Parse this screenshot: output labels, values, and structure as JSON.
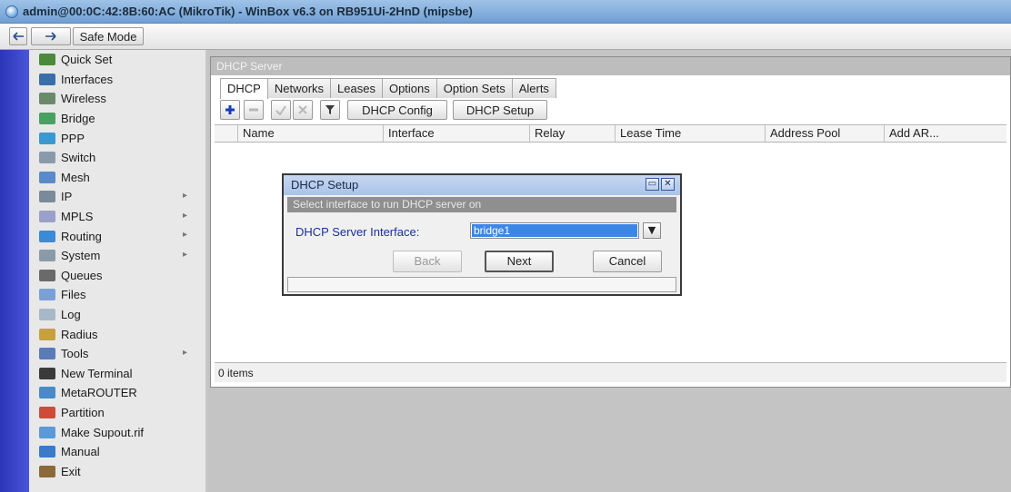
{
  "window": {
    "title": "admin@00:0C:42:8B:60:AC (MikroTik) - WinBox v6.3 on RB951Ui-2HnD (mipsbe)"
  },
  "toolbar": {
    "undo_icon": "undo-icon",
    "redo_icon": "redo-icon",
    "safe_mode_label": "Safe Mode"
  },
  "sidebar": {
    "items": [
      {
        "label": "Quick Set",
        "icon": "quick-set-icon",
        "color": "#4a8a3a",
        "submenu": false
      },
      {
        "label": "Interfaces",
        "icon": "interfaces-icon",
        "color": "#3a6ea8",
        "submenu": false
      },
      {
        "label": "Wireless",
        "icon": "wireless-icon",
        "color": "#6a8a6a",
        "submenu": false
      },
      {
        "label": "Bridge",
        "icon": "bridge-icon",
        "color": "#4aa060",
        "submenu": false
      },
      {
        "label": "PPP",
        "icon": "ppp-icon",
        "color": "#3a9ad0",
        "submenu": false
      },
      {
        "label": "Switch",
        "icon": "switch-icon",
        "color": "#8a9aaa",
        "submenu": false
      },
      {
        "label": "Mesh",
        "icon": "mesh-icon",
        "color": "#5a8ac8",
        "submenu": false
      },
      {
        "label": "IP",
        "icon": "ip-icon",
        "color": "#7a8a9a",
        "submenu": true
      },
      {
        "label": "MPLS",
        "icon": "mpls-icon",
        "color": "#9aa0c8",
        "submenu": true
      },
      {
        "label": "Routing",
        "icon": "routing-icon",
        "color": "#3a8ad8",
        "submenu": true
      },
      {
        "label": "System",
        "icon": "system-icon",
        "color": "#8a9aa8",
        "submenu": true
      },
      {
        "label": "Queues",
        "icon": "queues-icon",
        "color": "#6a6a6a",
        "submenu": false
      },
      {
        "label": "Files",
        "icon": "files-icon",
        "color": "#7aa0d8",
        "submenu": false
      },
      {
        "label": "Log",
        "icon": "log-icon",
        "color": "#a8b8c8",
        "submenu": false
      },
      {
        "label": "Radius",
        "icon": "radius-icon",
        "color": "#c8a040",
        "submenu": false
      },
      {
        "label": "Tools",
        "icon": "tools-icon",
        "color": "#5a7ab8",
        "submenu": true
      },
      {
        "label": "New Terminal",
        "icon": "terminal-icon",
        "color": "#3a3a3a",
        "submenu": false
      },
      {
        "label": "MetaROUTER",
        "icon": "metarouter-icon",
        "color": "#4a8ac8",
        "submenu": false
      },
      {
        "label": "Partition",
        "icon": "partition-icon",
        "color": "#d04a3a",
        "submenu": false
      },
      {
        "label": "Make Supout.rif",
        "icon": "supout-icon",
        "color": "#5a9ad8",
        "submenu": false
      },
      {
        "label": "Manual",
        "icon": "manual-icon",
        "color": "#3a7ac8",
        "submenu": false
      },
      {
        "label": "Exit",
        "icon": "exit-icon",
        "color": "#8a6a3a",
        "submenu": false
      }
    ]
  },
  "dhcp_window": {
    "title": "DHCP Server",
    "tabs": [
      "DHCP",
      "Networks",
      "Leases",
      "Options",
      "Option Sets",
      "Alerts"
    ],
    "active_tab": "DHCP",
    "buttons": {
      "dhcp_config": "DHCP Config",
      "dhcp_setup": "DHCP Setup"
    },
    "columns": [
      "Name",
      "Interface",
      "Relay",
      "Lease Time",
      "Address Pool",
      "Add AR..."
    ],
    "status": "0 items"
  },
  "dialog": {
    "title": "DHCP Setup",
    "instruction": "Select interface to run DHCP server on",
    "field_label": "DHCP Server Interface:",
    "field_value": "bridge1",
    "buttons": {
      "back": "Back",
      "next": "Next",
      "cancel": "Cancel"
    }
  },
  "colors": {
    "sidebar_stripe": "#2b35b8",
    "selection": "#3e86e6",
    "label_blue": "#1a2fa0"
  }
}
